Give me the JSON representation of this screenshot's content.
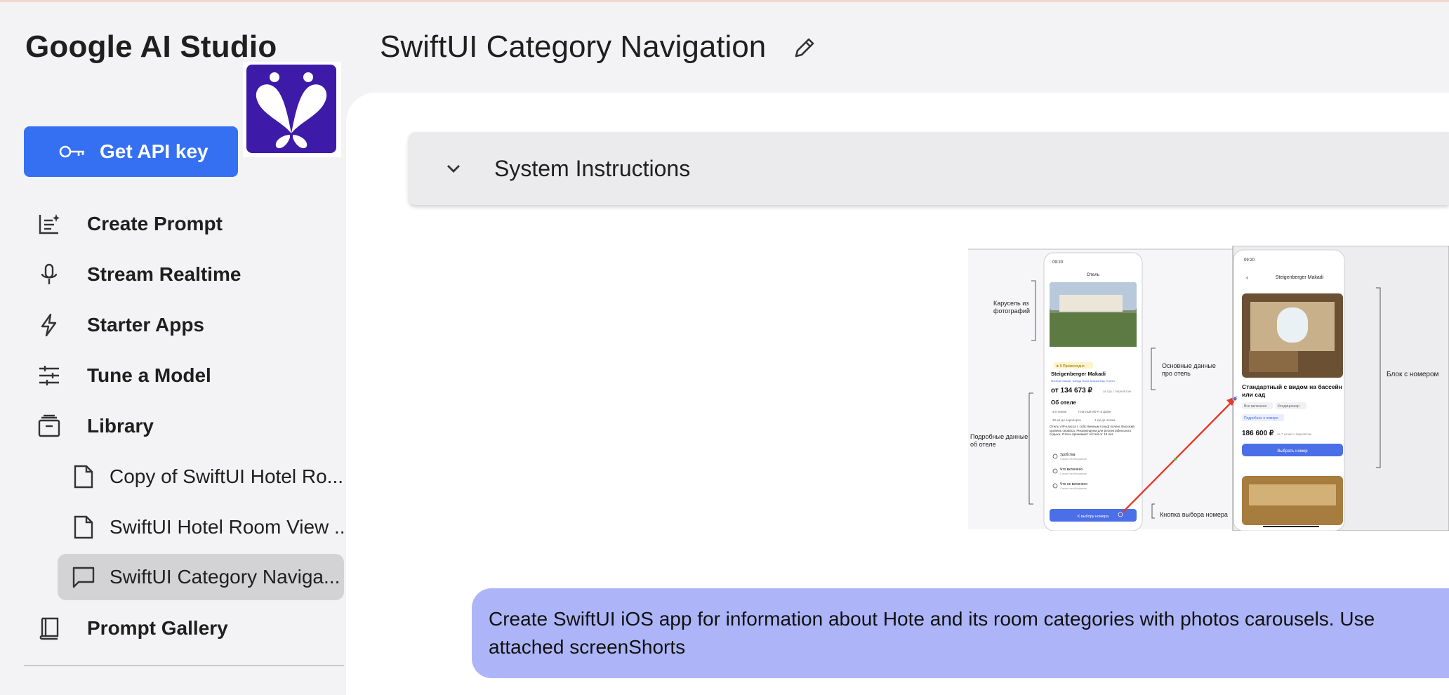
{
  "app": {
    "brand": "Google AI Studio",
    "logo_icon": "app-butterfly-logo"
  },
  "sidebar": {
    "api_key_label": "Get API key",
    "items": [
      {
        "label": "Create Prompt",
        "icon": "create-prompt-icon"
      },
      {
        "label": "Stream Realtime",
        "icon": "microphone-icon"
      },
      {
        "label": "Starter Apps",
        "icon": "bolt-icon"
      },
      {
        "label": "Tune a Model",
        "icon": "tune-sliders-icon"
      },
      {
        "label": "Library",
        "icon": "library-icon"
      }
    ],
    "library_items": [
      {
        "label": "Copy of SwiftUI Hotel Ro...",
        "icon": "document-icon"
      },
      {
        "label": "SwiftUI Hotel Room View ...",
        "icon": "document-icon"
      },
      {
        "label": "SwiftUI Category Naviga...",
        "icon": "chat-icon",
        "active": true
      }
    ],
    "gallery_label": "Prompt Gallery"
  },
  "header": {
    "title": "SwiftUI Category Navigation"
  },
  "main": {
    "system_instructions_label": "System Instructions",
    "attachment": {
      "left_phone": {
        "time": "09:20",
        "header": "Отель",
        "badge": "★ 5 Превосходно",
        "hotel_name": "Steigenberger Makadi",
        "address": "Madinat Makadi, Safaga Road, Makadi Bay, Египет",
        "price": "от 134 673 ₽",
        "price_note": "за тур с перелётом",
        "about_title": "Об отеле",
        "chips": [
          "3-я линия",
          "Платный Wi-Fi в фойе",
          "30 км до аэропорта",
          "1 км до пляжа"
        ],
        "about_text": "Отель VIP-класса с собственным гольф полем. Высокий уровень сервиса. Рекомендуем для респектабельного отдыха. Отель принимает гостей от 18 лет.",
        "rows": [
          {
            "title": "Удобства",
            "sub": "Самое необходимое"
          },
          {
            "title": "Что включено",
            "sub": "Самое необходимое"
          },
          {
            "title": "Что не включено",
            "sub": "Самое необходимое"
          }
        ],
        "cta": "К выбору номера"
      },
      "right_phone": {
        "time": "09:20",
        "header": "Steigenberger Makadi",
        "room_title_1": "Стандартный с видом на бассейн",
        "room_title_2": "или сад",
        "chips": [
          "Все включено",
          "Кондиционер"
        ],
        "details_link": "Подробнее о номере",
        "price": "186 600 ₽",
        "price_note": "за 7 ночей с перелётом",
        "cta": "Выбрать номер"
      },
      "annotations": {
        "carousel_1": "Карусель из",
        "carousel_2": "фотографий",
        "basic_1": "Основные данные",
        "basic_2": "про отель",
        "detailed_1": "Подробные данные",
        "detailed_2": "об отеле",
        "button_label": "Кнопка выбора номера",
        "room_block": "Блок с номером"
      }
    },
    "prompt_text": "Create SwiftUI iOS app for information about Hote and its room categories with photos carousels. Use attached screenShorts"
  },
  "colors": {
    "accent": "#3570f2",
    "bubble": "#adb5f8",
    "logo": "#3e1aa8",
    "arrow": "#e53a2a"
  }
}
